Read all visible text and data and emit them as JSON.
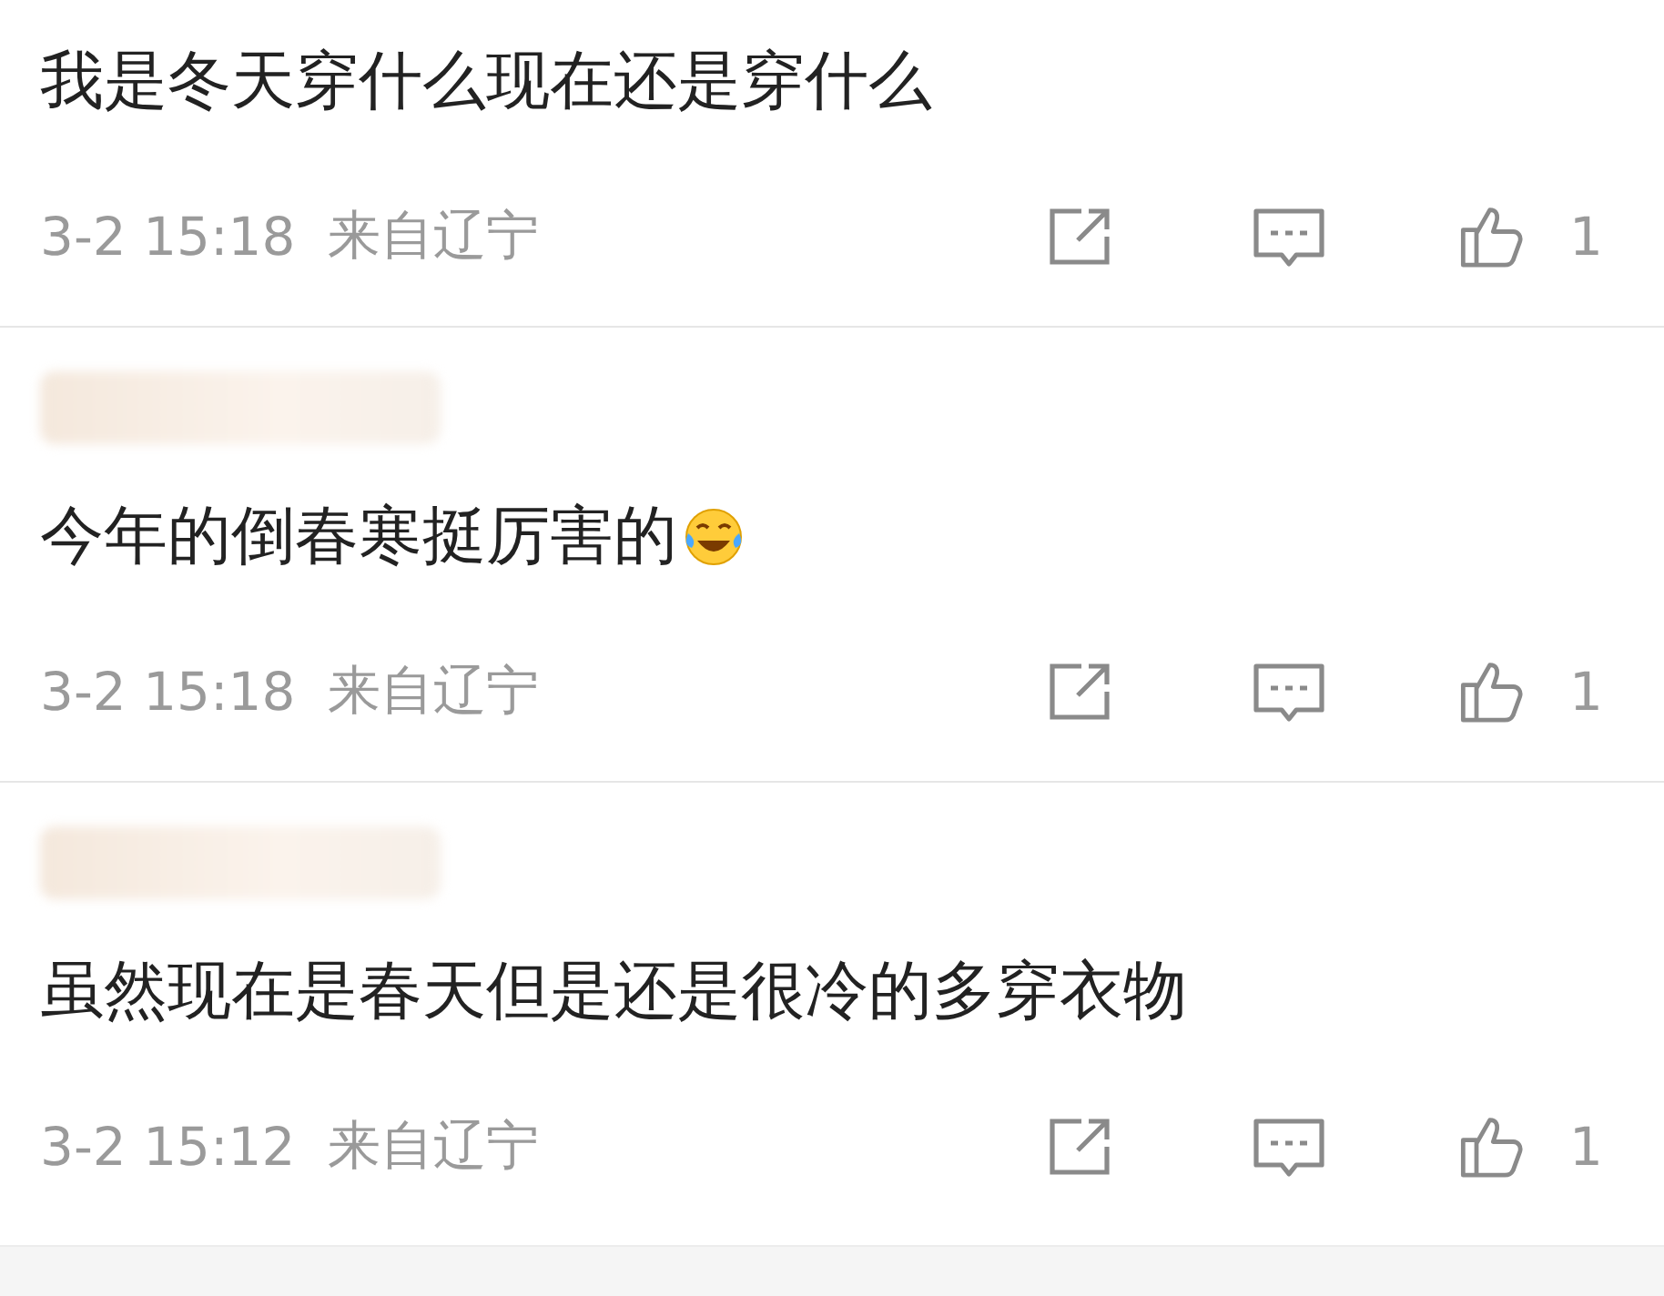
{
  "comments": [
    {
      "name_hidden": false,
      "text": "我是冬天穿什么现在还是穿什么",
      "emoji": false,
      "time": "3-2 15:18",
      "location": "来自辽宁",
      "likes": "1"
    },
    {
      "name_hidden": true,
      "text": "今年的倒春寒挺厉害的",
      "emoji": true,
      "time": "3-2 15:18",
      "location": "来自辽宁",
      "likes": "1"
    },
    {
      "name_hidden": true,
      "text": "虽然现在是春天但是还是很冷的多穿衣物",
      "emoji": false,
      "time": "3-2 15:12",
      "location": "来自辽宁",
      "likes": "1"
    }
  ]
}
